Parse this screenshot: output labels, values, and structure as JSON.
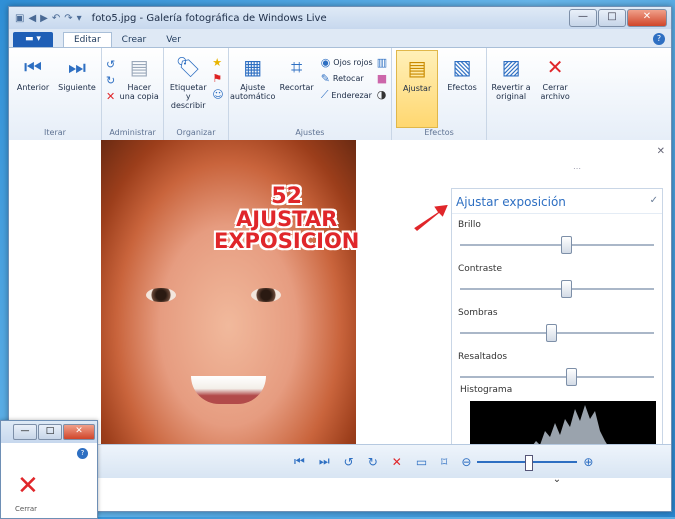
{
  "titlebar": {
    "title": "foto5.jpg - Galería fotográfica de Windows Live",
    "minimize": "—",
    "maximize": "□",
    "close": "✕"
  },
  "tabs": {
    "file": "▬ ▾",
    "items": [
      "Editar",
      "Crear",
      "Ver"
    ],
    "active": "Editar",
    "help": "?"
  },
  "ribbon": {
    "groups": [
      {
        "label": "Iterar",
        "buttons": [
          {
            "label": "Anterior",
            "icon": "prev-icon"
          },
          {
            "label": "Siguiente",
            "icon": "next-icon"
          }
        ]
      },
      {
        "label": "Administrar",
        "buttons": [
          {
            "label": "Hacer una copia",
            "icon": "copy-icon"
          }
        ]
      },
      {
        "label": "Organizar",
        "buttons": [
          {
            "label": "Etiquetar y describir",
            "icon": "tag-icon"
          }
        ]
      },
      {
        "label": "Ajustes",
        "buttons": [
          {
            "label": "Ajuste automático",
            "icon": "autofix-icon"
          },
          {
            "label": "Recortar",
            "icon": "crop-icon"
          }
        ]
      },
      {
        "label": "Ajustes",
        "small": [
          "Ojos rojos",
          "Retocar",
          "Enderezar"
        ]
      },
      {
        "label": "Efectos",
        "buttons": [
          {
            "label": "Ajustar",
            "icon": "adjust-icon"
          },
          {
            "label": "Efectos",
            "icon": "effects-icon"
          }
        ]
      },
      {
        "label": "",
        "buttons": [
          {
            "label": "Revertir a original",
            "icon": "revert-icon"
          },
          {
            "label": "Cerrar archivo",
            "icon": "close-file-icon"
          }
        ]
      }
    ]
  },
  "overlay": {
    "number": "52",
    "line1": "AJUSTAR",
    "line2": "EXPOSICION"
  },
  "panel": {
    "title": "Ajustar exposición",
    "sliders": [
      {
        "label": "Brillo",
        "value": 0.55
      },
      {
        "label": "Contraste",
        "value": 0.55
      },
      {
        "label": "Sombras",
        "value": 0.47
      },
      {
        "label": "Resaltados",
        "value": 0.58
      }
    ],
    "histogram_label": "Histograma"
  },
  "inset": {
    "caption": "Cerrar"
  },
  "colors": {
    "accent": "#2e6fc2",
    "warning": "#e0262a"
  }
}
